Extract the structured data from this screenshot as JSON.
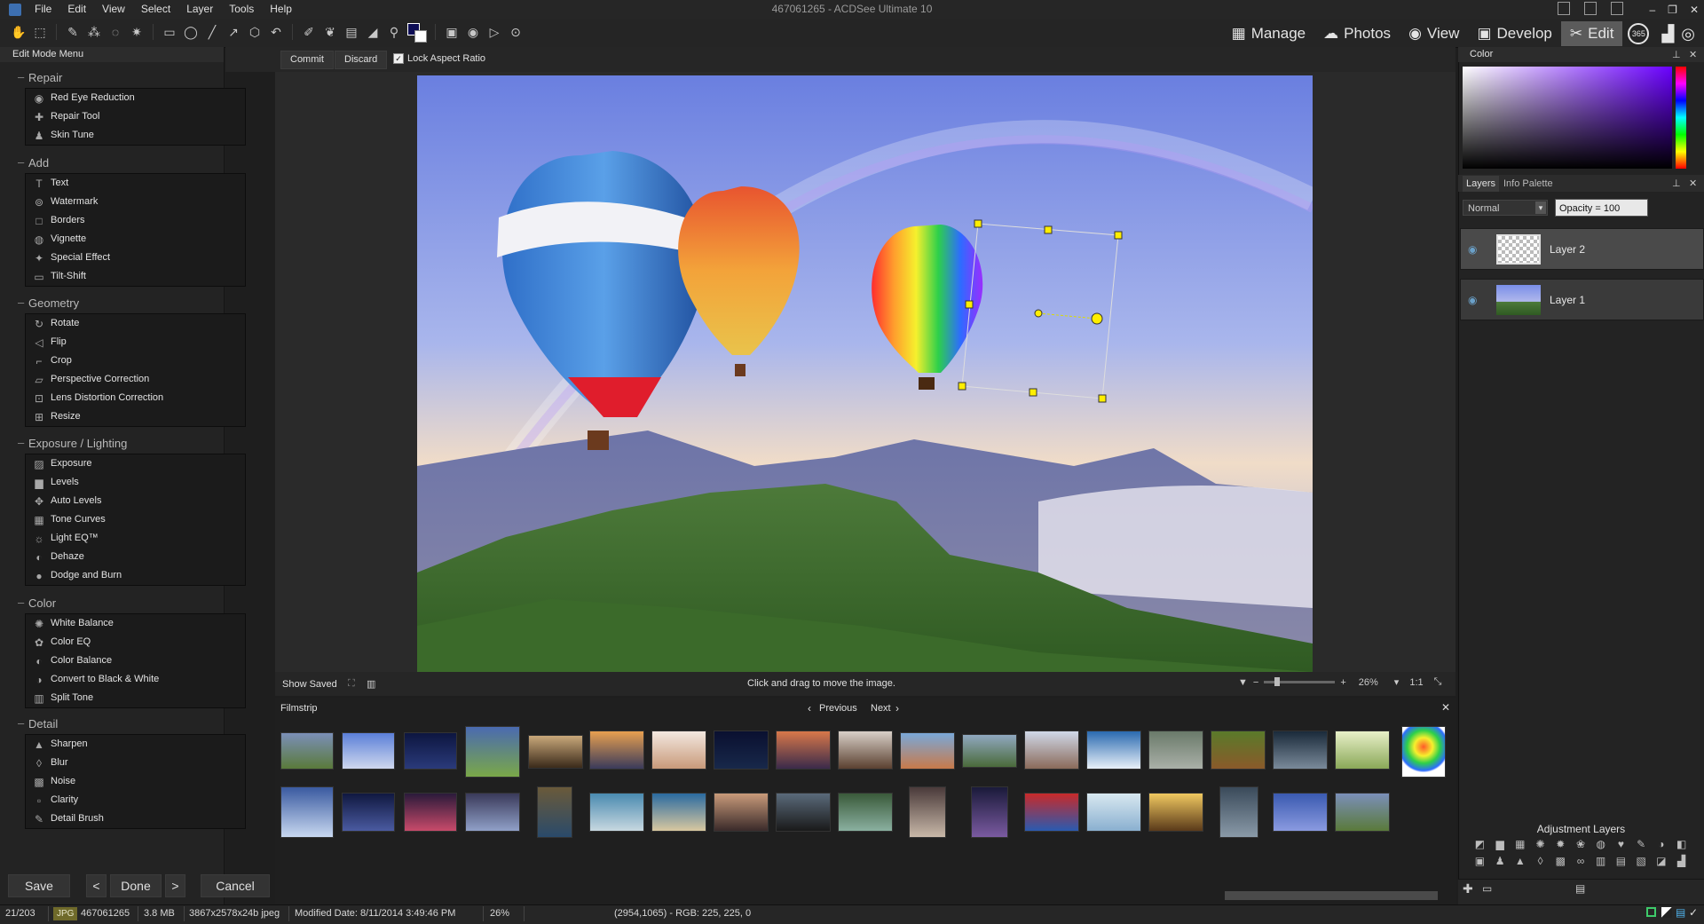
{
  "window": {
    "title": "467061265 - ACDSee Ultimate 10",
    "controls": [
      "–",
      "❐",
      "✕"
    ]
  },
  "menu": [
    "File",
    "Edit",
    "View",
    "Select",
    "Layer",
    "Tools",
    "Help"
  ],
  "modes": [
    {
      "label": "Manage",
      "icon": "grid-icon"
    },
    {
      "label": "Photos",
      "icon": "photos-icon"
    },
    {
      "label": "View",
      "icon": "eye-icon"
    },
    {
      "label": "Develop",
      "icon": "develop-icon"
    },
    {
      "label": "Edit",
      "icon": "edit-icon",
      "active": true
    }
  ],
  "mode_extra": "365",
  "commit": {
    "commit_label": "Commit",
    "discard_label": "Discard",
    "lock_label": "Lock Aspect Ratio",
    "lock_checked": true
  },
  "left_panel": {
    "title": "Edit Mode Menu",
    "sections": [
      {
        "title": "Repair",
        "items": [
          {
            "label": "Red Eye Reduction",
            "icon": "eye-icon"
          },
          {
            "label": "Repair Tool",
            "icon": "bandage-icon"
          },
          {
            "label": "Skin Tune",
            "icon": "person-icon"
          }
        ]
      },
      {
        "title": "Add",
        "items": [
          {
            "label": "Text",
            "icon": "text-icon"
          },
          {
            "label": "Watermark",
            "icon": "watermark-icon"
          },
          {
            "label": "Borders",
            "icon": "border-icon"
          },
          {
            "label": "Vignette",
            "icon": "vignette-icon"
          },
          {
            "label": "Special Effect",
            "icon": "wand-icon"
          },
          {
            "label": "Tilt-Shift",
            "icon": "tiltshift-icon"
          }
        ]
      },
      {
        "title": "Geometry",
        "items": [
          {
            "label": "Rotate",
            "icon": "rotate-icon"
          },
          {
            "label": "Flip",
            "icon": "flip-icon"
          },
          {
            "label": "Crop",
            "icon": "crop-icon"
          },
          {
            "label": "Perspective Correction",
            "icon": "perspective-icon"
          },
          {
            "label": "Lens Distortion Correction",
            "icon": "lens-icon"
          },
          {
            "label": "Resize",
            "icon": "resize-icon"
          }
        ]
      },
      {
        "title": "Exposure / Lighting",
        "items": [
          {
            "label": "Exposure",
            "icon": "exposure-icon"
          },
          {
            "label": "Levels",
            "icon": "levels-icon"
          },
          {
            "label": "Auto Levels",
            "icon": "auto-levels-icon"
          },
          {
            "label": "Tone Curves",
            "icon": "curves-icon"
          },
          {
            "label": "Light EQ™",
            "icon": "lighteq-icon"
          },
          {
            "label": "Dehaze",
            "icon": "dehaze-icon"
          },
          {
            "label": "Dodge and Burn",
            "icon": "dodge-icon"
          }
        ]
      },
      {
        "title": "Color",
        "items": [
          {
            "label": "White Balance",
            "icon": "whitebalance-icon"
          },
          {
            "label": "Color EQ",
            "icon": "coloreq-icon"
          },
          {
            "label": "Color Balance",
            "icon": "colorbalance-icon"
          },
          {
            "label": "Convert to Black & White",
            "icon": "bw-icon"
          },
          {
            "label": "Split Tone",
            "icon": "splittone-icon"
          }
        ]
      },
      {
        "title": "Detail",
        "items": [
          {
            "label": "Sharpen",
            "icon": "sharpen-icon"
          },
          {
            "label": "Blur",
            "icon": "blur-icon"
          },
          {
            "label": "Noise",
            "icon": "noise-icon"
          },
          {
            "label": "Clarity",
            "icon": "clarity-icon"
          },
          {
            "label": "Detail Brush",
            "icon": "brush-icon"
          }
        ]
      }
    ],
    "buttons": {
      "save": "Save",
      "prev": "<",
      "done": "Done",
      "next": ">",
      "cancel": "Cancel"
    }
  },
  "canvas": {
    "show_saved": "Show Saved",
    "hint": "Click and drag to move the image.",
    "zoom": "26%",
    "ratio": "1:1"
  },
  "filmstrip": {
    "tab": "Filmstrip",
    "prev": "Previous",
    "next": "Next",
    "close": "✕"
  },
  "right_panel": {
    "color_title": "Color",
    "layers_tab": "Layers",
    "info_tab": "Info Palette",
    "blend_mode": "Normal",
    "opacity": "Opacity = 100",
    "layers": [
      {
        "name": "Layer 2",
        "selected": true
      },
      {
        "name": "Layer 1",
        "selected": false
      }
    ],
    "adjustment_title": "Adjustment Layers"
  },
  "status": {
    "index": "21/203",
    "type": "JPG",
    "name": "467061265",
    "size": "3.8 MB",
    "dims": "3867x2578x24b jpeg",
    "modified": "Modified Date: 8/11/2014 3:49:46 PM",
    "zoom": "26%",
    "pixel": "(2954,1065) - RGB: 225, 225, 0"
  },
  "colors": {
    "accent": "#5b5b5b",
    "handle": "#ffee00",
    "foreground": "#0d0d55"
  }
}
